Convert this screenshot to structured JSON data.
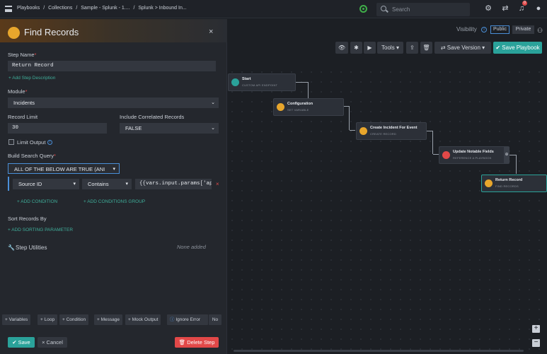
{
  "breadcrumbs": [
    "Playbooks",
    "/",
    "Collections",
    "/",
    "Sample - Splunk - 1....",
    "/",
    "Splunk > Inbound In..."
  ],
  "search": {
    "placeholder": "Search"
  },
  "notifications_count": "0",
  "visibility": {
    "label": "Visibility",
    "public": "Public",
    "private": "Private"
  },
  "toolbar": {
    "tools": "Tools",
    "save_version": "Save Version",
    "save_playbook": "Save Playbook"
  },
  "nodes": [
    {
      "title": "Start",
      "subtitle": "CUSTOM API ENDPOINT",
      "color": "#2aa29a"
    },
    {
      "title": "Configuration",
      "subtitle": "SET VARIABLE",
      "color": "#e8a62c"
    },
    {
      "title": "Create Incident For Event",
      "subtitle": "CREATE RECORD",
      "color": "#e8a62c"
    },
    {
      "title": "Update Notable Fields",
      "subtitle": "REFERENCE A PLAYBOOK",
      "color": "#e24848"
    },
    {
      "title": "Return Record",
      "subtitle": "FIND RECORDS",
      "color": "#e8a62c"
    }
  ],
  "panel": {
    "title": "Find Records",
    "step_name_label": "Step Name",
    "step_name_value": "Return Record",
    "add_desc": "+ Add Step Description",
    "module_label": "Module",
    "module_value": "Incidents",
    "record_limit_label": "Record Limit",
    "record_limit_value": "30",
    "include_corr_label": "Include Correlated Records",
    "include_corr_value": "FALSE",
    "limit_output": "Limit Output",
    "build_query_label": "Build Search Query",
    "query_logic": "ALL OF THE BELOW ARE TRUE (ANI",
    "cond_field": "Source ID",
    "cond_op": "Contains",
    "cond_value": "{{vars.input.params['api",
    "add_condition": "+ ADD CONDITION",
    "add_group": "+ ADD CONDITIONS GROUP",
    "sort_label": "Sort Records By",
    "add_sort": "+ ADD SORTING PARAMETER",
    "utilities_label": "Step Utilities",
    "utilities_value": "None added",
    "footer": {
      "variables": "+ Variables",
      "loop": "+ Loop",
      "condition": "+ Condition",
      "message": "+ Message",
      "mock": "+ Mock Output",
      "ignore": "Ignore Error",
      "ignore_value": "No"
    },
    "save": "Save",
    "cancel": "Cancel",
    "delete": "Delete Step"
  }
}
